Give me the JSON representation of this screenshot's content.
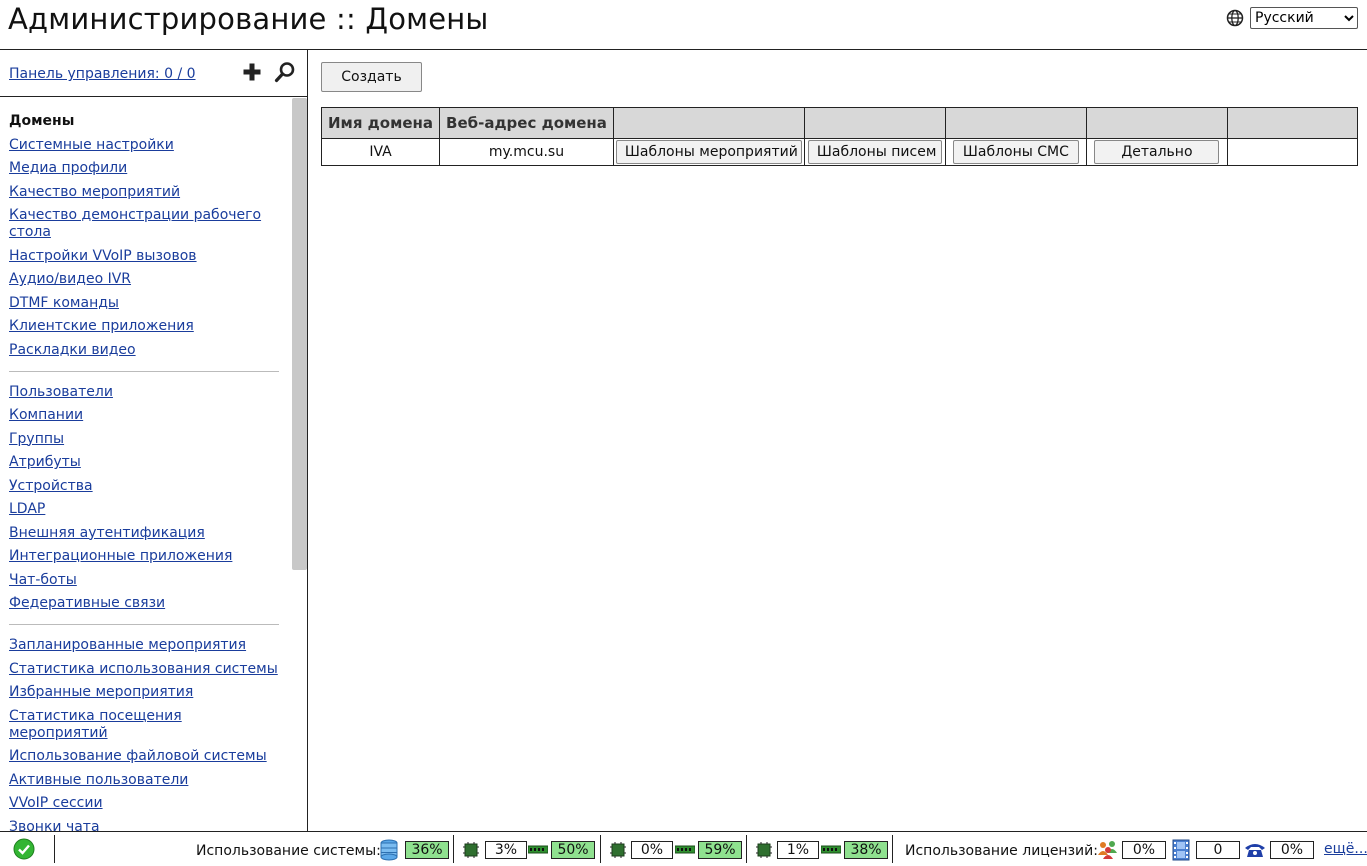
{
  "header": {
    "title": "Администрирование :: Домены",
    "language": "Русский"
  },
  "sidebar": {
    "control_panel_link": "Панель управления: 0 / 0",
    "groups": [
      [
        {
          "label": "Домены",
          "current": true
        },
        {
          "label": "Системные настройки"
        },
        {
          "label": "Медиа профили"
        },
        {
          "label": "Качество мероприятий"
        },
        {
          "label": "Качество демонстрации рабочего стола"
        },
        {
          "label": "Настройки VVoIP вызовов"
        },
        {
          "label": "Аудио/видео IVR"
        },
        {
          "label": "DTMF команды"
        },
        {
          "label": "Клиентские приложения"
        },
        {
          "label": "Раскладки видео"
        }
      ],
      [
        {
          "label": "Пользователи"
        },
        {
          "label": "Компании"
        },
        {
          "label": "Группы"
        },
        {
          "label": "Атрибуты"
        },
        {
          "label": "Устройства"
        },
        {
          "label": "LDAP"
        },
        {
          "label": "Внешняя аутентификация"
        },
        {
          "label": "Интеграционные приложения"
        },
        {
          "label": "Чат-боты"
        },
        {
          "label": "Федеративные связи"
        }
      ],
      [
        {
          "label": "Запланированные мероприятия"
        },
        {
          "label": "Статистика использования системы"
        },
        {
          "label": "Избранные мероприятия"
        },
        {
          "label": "Статистика посещения мероприятий"
        },
        {
          "label": "Использование файловой системы"
        },
        {
          "label": "Активные пользователи"
        },
        {
          "label": "VVoIP сессии"
        },
        {
          "label": "Звонки чата"
        }
      ]
    ]
  },
  "main": {
    "create_button": "Создать",
    "table": {
      "columns": [
        "Имя домена",
        "Веб-адрес домена",
        "",
        "",
        "",
        ""
      ],
      "rows": [
        {
          "name": "IVA",
          "url": "my.mcu.su",
          "event_templates_button": "Шаблоны мероприятий",
          "email_templates_button": "Шаблоны писем",
          "sms_templates_button": "Шаблоны СМС",
          "details_button": "Детально"
        }
      ]
    }
  },
  "status_bar": {
    "system_usage_label": "Использование системы:",
    "storage_pct": "36%",
    "servers": [
      {
        "cpu": "3%",
        "ram": "50%"
      },
      {
        "cpu": "0%",
        "ram": "59%"
      },
      {
        "cpu": "1%",
        "ram": "38%"
      }
    ],
    "license_usage_label": "Использование лицензий:",
    "licenses": {
      "users": "0%",
      "video": "0",
      "phone": "0%"
    },
    "more_link": "ещё..."
  },
  "colors": {
    "link": "#1a3d9c",
    "usage_green": "#8fe18f",
    "header_gray": "#d8d8d8"
  },
  "icons": [
    "globe-icon",
    "plus-icon",
    "magnifier-icon",
    "ok-check-icon",
    "storage-icon",
    "cpu-chip-icon",
    "ram-module-icon",
    "users-icon",
    "video-film-icon",
    "phone-icon"
  ]
}
